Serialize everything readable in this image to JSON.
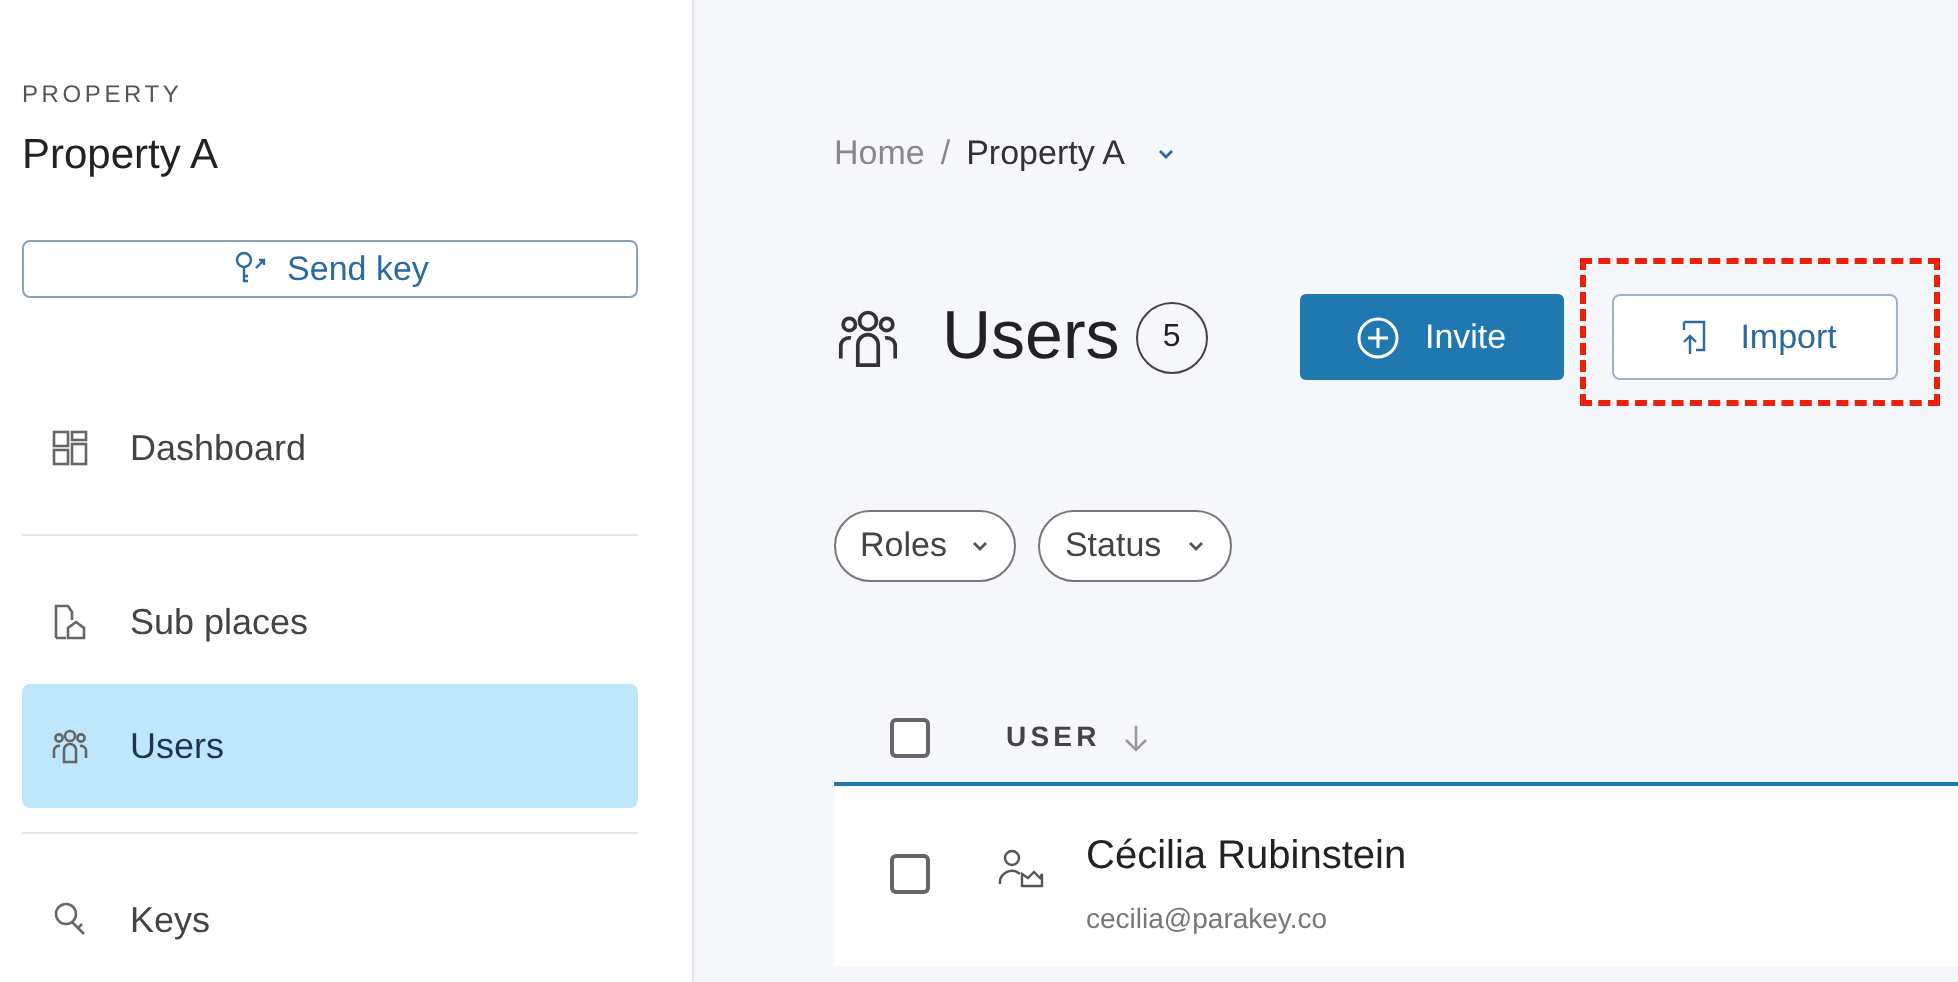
{
  "sidebar": {
    "section_label": "PROPERTY",
    "property_name": "Property A",
    "send_key_button": "Send key",
    "items": [
      {
        "label": "Dashboard",
        "kind": "dashboard",
        "selected": false
      },
      {
        "label": "Sub places",
        "kind": "subplaces",
        "selected": false
      },
      {
        "label": "Users",
        "kind": "users",
        "selected": true
      },
      {
        "label": "Keys",
        "kind": "keys",
        "selected": false
      }
    ]
  },
  "breadcrumb": {
    "home": "Home",
    "separator": "/",
    "current": "Property A"
  },
  "header": {
    "title": "Users",
    "count": "5",
    "invite_button": "Invite",
    "import_button": "Import",
    "import_highlighted": true
  },
  "filters": [
    {
      "label": "Roles"
    },
    {
      "label": "Status"
    }
  ],
  "table": {
    "select_all_checked": false,
    "columns": [
      {
        "label": "USER",
        "sorted": true
      }
    ],
    "rows": [
      {
        "name": "Cécilia Rubinstein",
        "email": "cecilia@parakey.co",
        "checked": false
      }
    ]
  }
}
